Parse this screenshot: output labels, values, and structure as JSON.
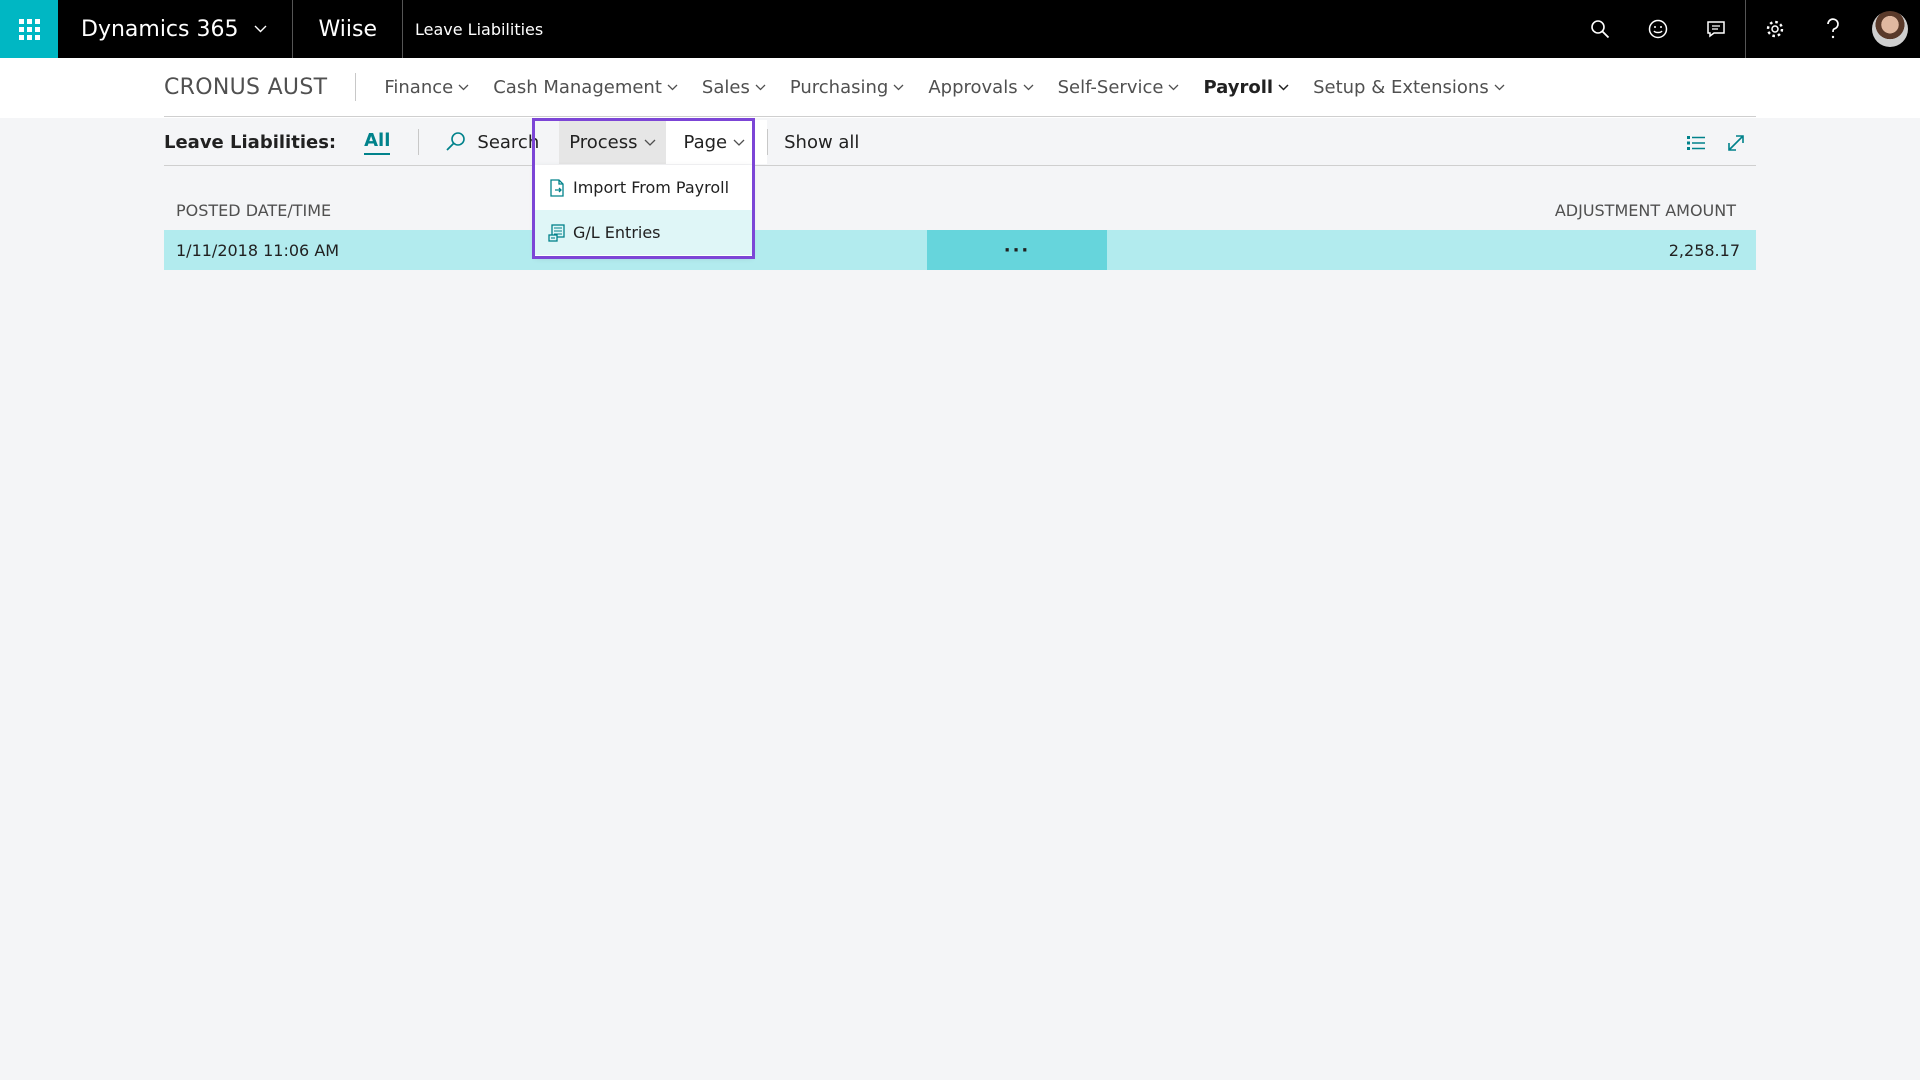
{
  "topbar": {
    "app_name": "Dynamics 365",
    "tenant": "Wiise",
    "breadcrumb": "Leave Liabilities"
  },
  "navbar": {
    "company": "CRONUS AUST",
    "items": [
      {
        "label": "Finance"
      },
      {
        "label": "Cash Management"
      },
      {
        "label": "Sales"
      },
      {
        "label": "Purchasing"
      },
      {
        "label": "Approvals"
      },
      {
        "label": "Self-Service"
      },
      {
        "label": "Payroll",
        "active": true
      },
      {
        "label": "Setup & Extensions"
      }
    ]
  },
  "actionbar": {
    "caption": "Leave Liabilities:",
    "filter": "All",
    "search_label": "Search",
    "process_label": "Process",
    "page_label": "Page",
    "show_all_label": "Show all"
  },
  "dropdown": {
    "items": [
      {
        "label": "Import From Payroll",
        "icon": "document-import-icon"
      },
      {
        "label": "G/L Entries",
        "icon": "ledger-entries-icon"
      }
    ]
  },
  "grid": {
    "columns": {
      "posted": "POSTED DATE/TIME",
      "amount": "ADJUSTMENT AMOUNT"
    },
    "rows": [
      {
        "posted": "1/11/2018 11:06 AM",
        "more": "···",
        "amount": "2,258.17"
      }
    ]
  },
  "colors": {
    "accent": "#00b7c3",
    "link": "#00828b",
    "row_selected": "#b2ebee",
    "row_more": "#66d5dc",
    "highlight": "#7c45d6"
  }
}
